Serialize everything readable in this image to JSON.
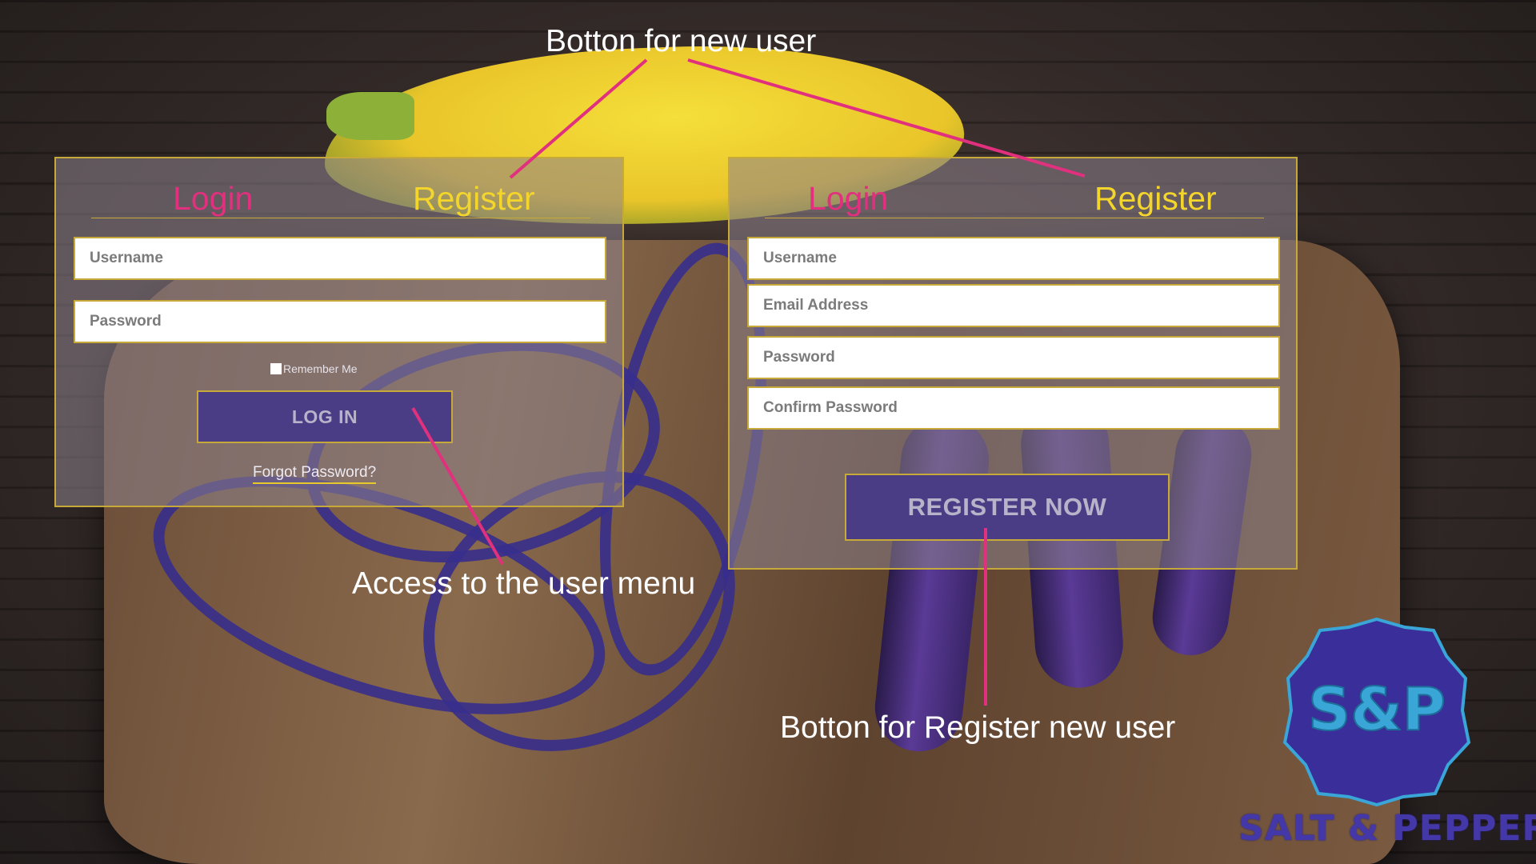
{
  "login_panel": {
    "tab_login": "Login",
    "tab_register": "Register",
    "username_placeholder": "Username",
    "password_placeholder": "Password",
    "remember_label": "Remember Me",
    "login_button": "LOG IN",
    "forgot_link": "Forgot Password?"
  },
  "register_panel": {
    "tab_login": "Login",
    "tab_register": "Register",
    "username_placeholder": "Username",
    "email_placeholder": "Email Address",
    "password_placeholder": "Password",
    "confirm_placeholder": "Confirm Password",
    "register_button": "REGISTER NOW"
  },
  "annotations": {
    "new_user": "Botton for new user",
    "user_menu": "Access to the user menu",
    "register_new_user": "Botton for Register new user"
  },
  "logo": {
    "monogram": "S&P",
    "name": "SALT & PEPPER"
  },
  "colors": {
    "accent_pink": "#e0307e",
    "accent_yellow": "#f3d52b",
    "button_purple": "#4a3d86",
    "logo_blue": "#3a2f9a"
  }
}
